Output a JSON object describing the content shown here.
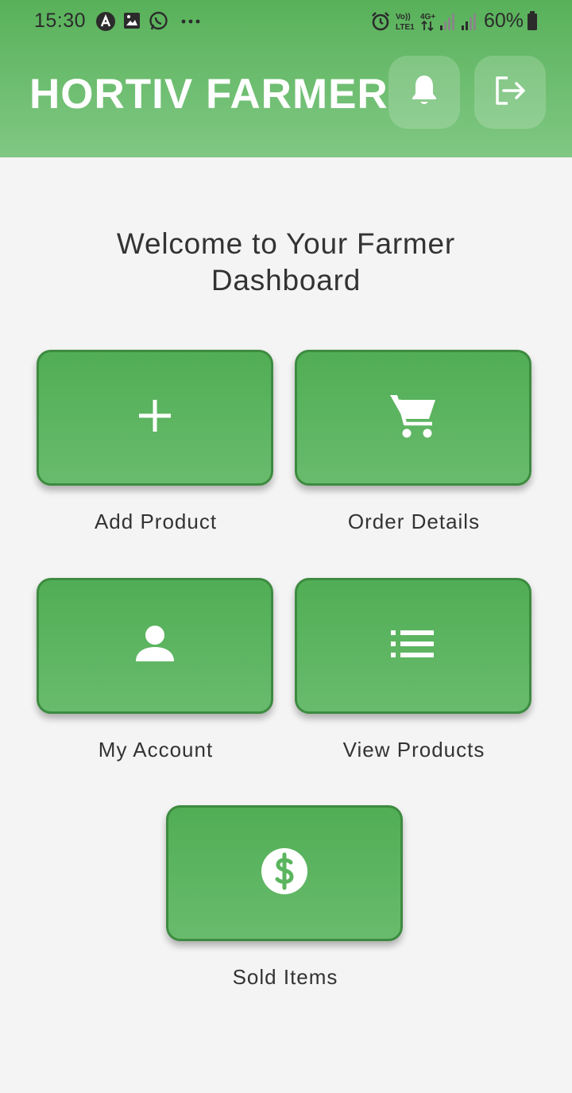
{
  "status_bar": {
    "time": "15:30",
    "battery": "60%",
    "icons": [
      "app-a-icon",
      "image-icon",
      "whatsapp-icon",
      "more-dots-icon",
      "alarm-icon",
      "volte-icon",
      "4g-icon",
      "signal-icon",
      "signal-icon",
      "battery-icon"
    ]
  },
  "header": {
    "title": "HORTIV FARMER",
    "buttons": [
      "bell-icon",
      "logout-icon"
    ]
  },
  "main": {
    "welcome": "Welcome to Your Farmer Dashboard",
    "tiles": [
      {
        "label": "Add Product",
        "icon": "plus-icon"
      },
      {
        "label": "Order Details",
        "icon": "cart-icon"
      },
      {
        "label": "My Account",
        "icon": "person-icon"
      },
      {
        "label": "View Products",
        "icon": "list-icon"
      },
      {
        "label": "Sold Items",
        "icon": "dollar-circle-icon"
      }
    ]
  },
  "colors": {
    "header_top": "#58b159",
    "header_bottom": "#80c884",
    "tile": "#57b15b",
    "tile_border": "#3d8b40",
    "background": "#f4f4f4"
  }
}
